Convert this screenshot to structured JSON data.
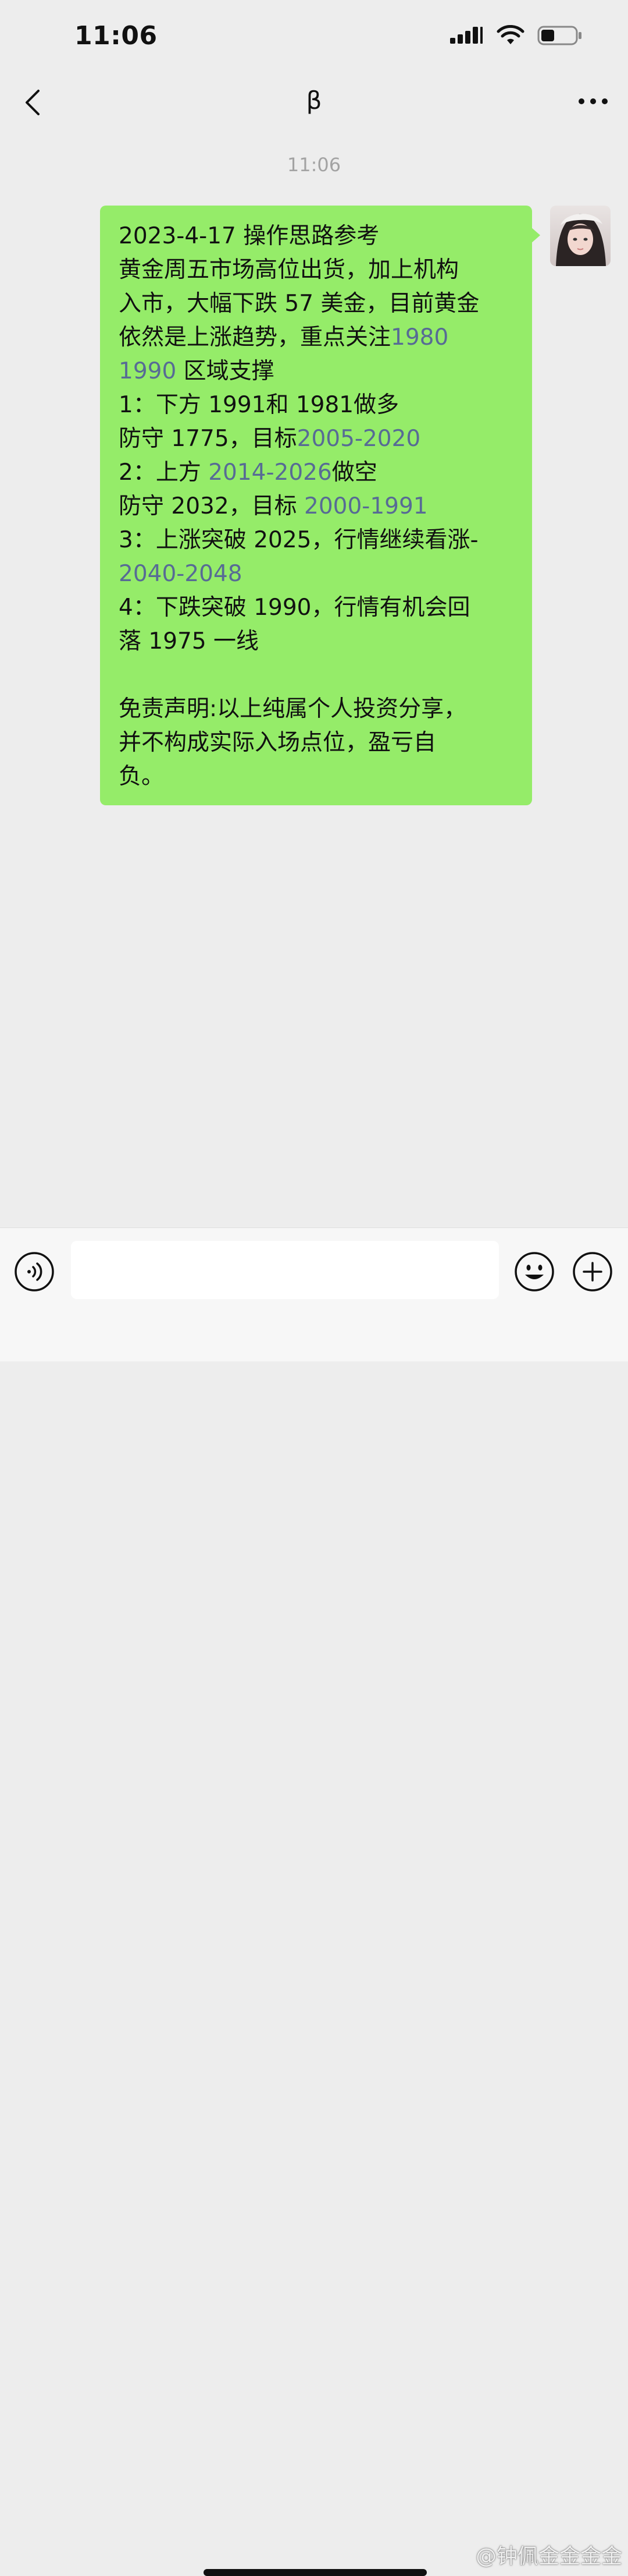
{
  "status_bar": {
    "time": "11:06"
  },
  "nav": {
    "title": "β"
  },
  "chat": {
    "timestamp": "11:06",
    "message": {
      "lines": [
        [
          {
            "t": "2023-4-17 操作思路参考"
          }
        ],
        [
          {
            "t": "黄金周五市场高位出货，加上机构"
          }
        ],
        [
          {
            "t": "入市，大幅下跌 57 美金，目前黄金"
          }
        ],
        [
          {
            "t": "依然是上涨趋势，重点关注"
          },
          {
            "t": "1980",
            "link": true
          }
        ],
        [
          {
            "t": "1990",
            "link": true
          },
          {
            "t": " 区域支撑"
          }
        ],
        [
          {
            "t": "1：下方 1991和 1981做多"
          }
        ],
        [
          {
            "t": "防守 1775，目标"
          },
          {
            "t": "2005-2020",
            "link": true
          }
        ],
        [
          {
            "t": "2：上方 "
          },
          {
            "t": "2014-2026",
            "link": true
          },
          {
            "t": "做空"
          }
        ],
        [
          {
            "t": "防守 2032，目标 "
          },
          {
            "t": "2000-1991",
            "link": true
          }
        ],
        [
          {
            "t": "3：上涨突破 2025，行情继续看涨-"
          }
        ],
        [
          {
            "t": "2040-2048",
            "link": true
          }
        ],
        [
          {
            "t": "4：下跌突破 1990，行情有机会回"
          }
        ],
        [
          {
            "t": "落 1975 一线"
          }
        ],
        [],
        [
          {
            "t": "免责声明:以上纯属个人投资分享，"
          }
        ],
        [
          {
            "t": "并不构成实际入场点位，盈亏自"
          }
        ],
        [
          {
            "t": "负。"
          }
        ]
      ]
    }
  },
  "input_bar": {
    "placeholder": ""
  },
  "watermark": {
    "text": "@钟佩金金金金"
  },
  "colors": {
    "background": "#ededed",
    "bubble": "#95ec69",
    "link": "#576b95"
  },
  "icons": {
    "back": "chevron-left-icon",
    "more": "more-dots-icon",
    "voice": "voice-icon",
    "emoji": "emoji-icon",
    "plus": "plus-icon"
  }
}
